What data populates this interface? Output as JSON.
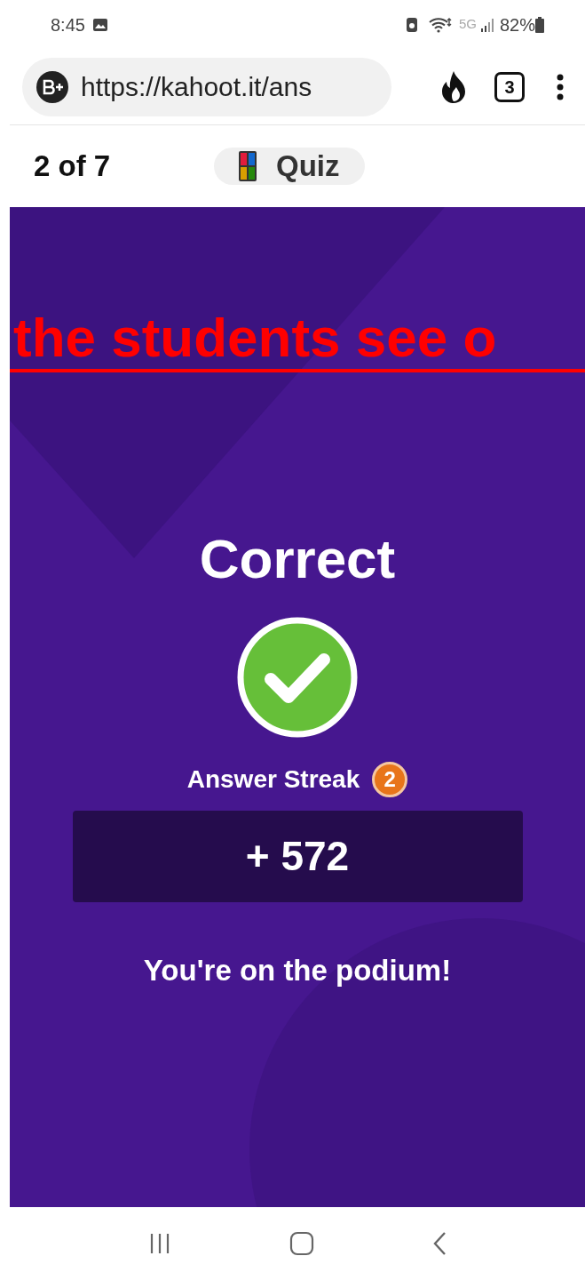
{
  "status_bar": {
    "time": "8:45",
    "network": "5G",
    "battery": "82%"
  },
  "browser": {
    "url": "https://kahoot.it/ans",
    "tab_count": "3"
  },
  "quiz_header": {
    "progress": "2 of 7",
    "mode": "Quiz"
  },
  "annotation": {
    "text": "the students see o"
  },
  "result": {
    "title": "Correct",
    "correct": true,
    "streak_label": "Answer Streak",
    "streak_count": "2",
    "points": "+ 572",
    "message": "You're on the podium!"
  }
}
